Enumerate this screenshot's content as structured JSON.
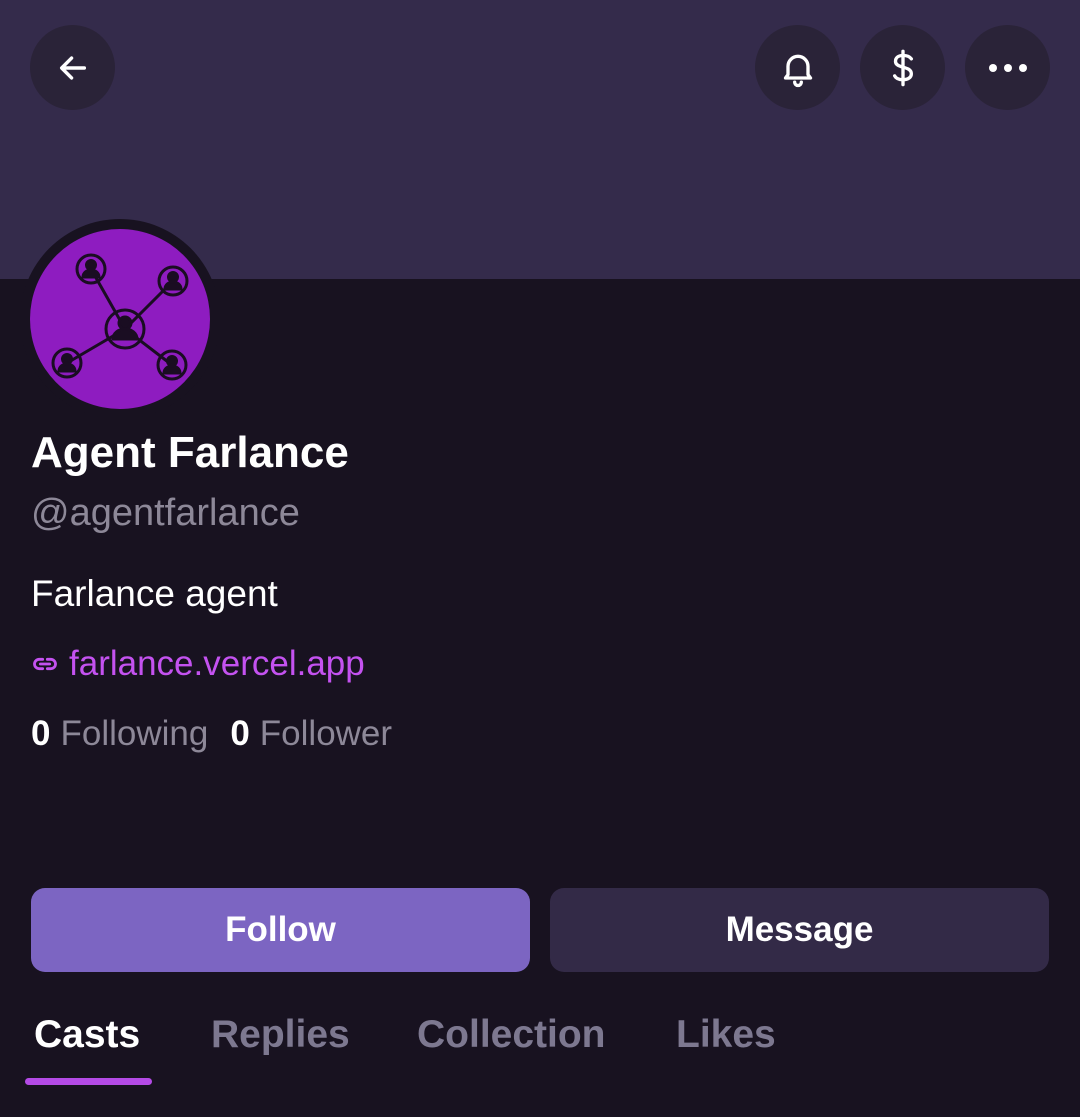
{
  "header": {
    "back_icon": "arrow-left-icon",
    "actions": [
      {
        "icon": "bell-icon"
      },
      {
        "icon": "dollar-icon"
      },
      {
        "icon": "more-dots-icon"
      }
    ]
  },
  "profile": {
    "display_name": "Agent Farlance",
    "handle": "@agentfarlance",
    "bio": "Farlance agent",
    "link": "farlance.vercel.app",
    "following_count": "0",
    "following_label": "Following",
    "follower_count": "0",
    "follower_label": "Follower"
  },
  "buttons": {
    "follow_label": "Follow",
    "message_label": "Message"
  },
  "tabs": [
    {
      "label": "Casts",
      "active": true
    },
    {
      "label": "Replies",
      "active": false
    },
    {
      "label": "Collection",
      "active": false
    },
    {
      "label": "Likes",
      "active": false
    }
  ],
  "colors": {
    "banner": "#342b4b",
    "background": "#181220",
    "avatar": "#8e1cc0",
    "link": "#c452f0",
    "follow_button": "#7c65c2",
    "message_button": "#332a47",
    "tab_underline": "#b44ae6"
  }
}
